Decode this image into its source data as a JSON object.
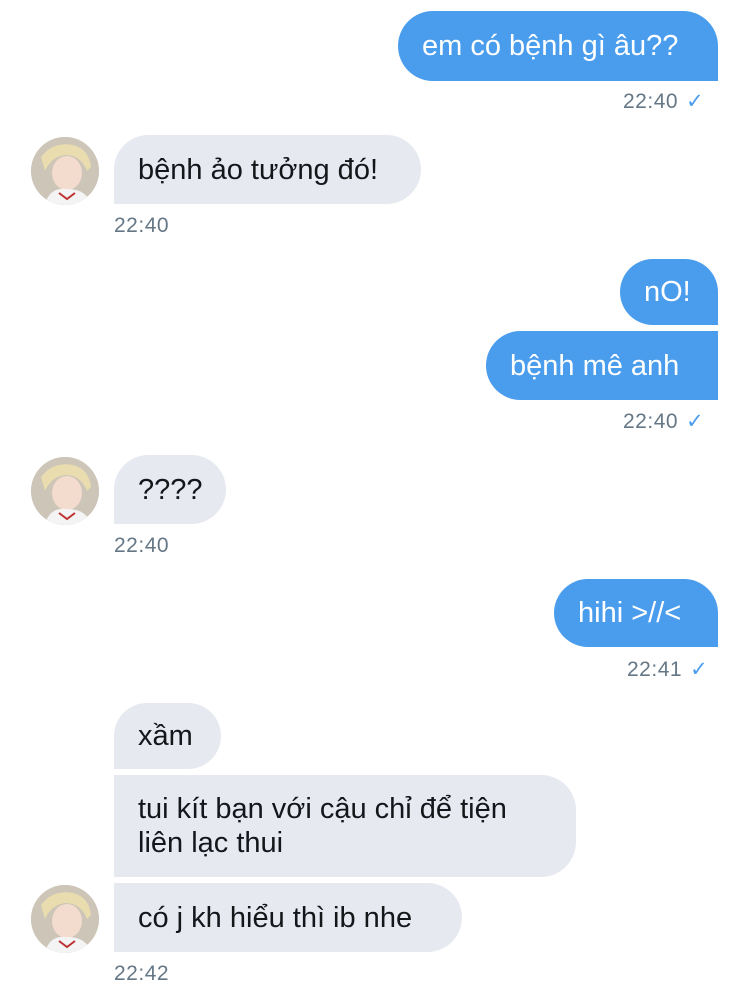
{
  "messages": {
    "m1": "em có bệnh gì âu??",
    "m2": "bệnh ảo tưởng đó!",
    "m3": "nO!",
    "m4": "bệnh mê anh",
    "m5": "????",
    "m6": "hihi >//<",
    "m7": "xầm",
    "m8": "tui kít bạn với cậu chỉ để tiện liên lạc thui",
    "m9": "có j kh hiểu thì ib nhe"
  },
  "times": {
    "t1": "22:40",
    "t2": "22:40",
    "t3": "22:40",
    "t4": "22:40",
    "t5": "22:41",
    "t6": "22:42"
  },
  "icons": {
    "check": "✓",
    "avatar": "avatar"
  },
  "colors": {
    "outgoing_bubble": "#4a9ded",
    "incoming_bubble": "#e6e9f0",
    "timestamp": "#657786",
    "read_check": "#4a9ded"
  }
}
